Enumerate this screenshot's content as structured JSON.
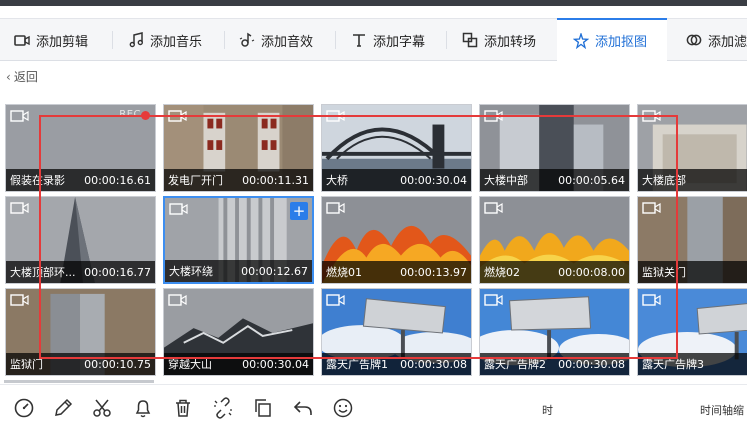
{
  "tabs": [
    {
      "label": "添加剪辑",
      "icon": "video-clip-icon"
    },
    {
      "label": "添加音乐",
      "icon": "music-note-icon"
    },
    {
      "label": "添加音效",
      "icon": "sound-effect-icon"
    },
    {
      "label": "添加字幕",
      "icon": "text-t-icon"
    },
    {
      "label": "添加转场",
      "icon": "transition-icon"
    },
    {
      "label": "添加抠图",
      "icon": "magic-star-icon",
      "active": true
    },
    {
      "label": "添加滤",
      "icon": "filter-icon"
    }
  ],
  "back": {
    "label": "返回"
  },
  "tiles": [
    {
      "name": "假装在录影",
      "duration": "00:00:16.61",
      "overlay": "REC"
    },
    {
      "name": "发电厂开门",
      "duration": "00:00:11.31"
    },
    {
      "name": "大桥",
      "duration": "00:00:30.04"
    },
    {
      "name": "大楼中部",
      "duration": "00:00:05.64"
    },
    {
      "name": "大楼底部",
      "duration": ""
    },
    {
      "name": "大楼顶部环...",
      "duration": "00:00:16.77"
    },
    {
      "name": "大楼环绕",
      "duration": "00:00:12.67",
      "selected": true,
      "add_label": "+"
    },
    {
      "name": "燃烧01",
      "duration": "00:00:13.97"
    },
    {
      "name": "燃烧02",
      "duration": "00:00:08.00"
    },
    {
      "name": "监狱关门",
      "duration": ""
    },
    {
      "name": "监狱门",
      "duration": "00:00:10.75"
    },
    {
      "name": "穿越大山",
      "duration": "00:00:30.04"
    },
    {
      "name": "露天广告牌1",
      "duration": "00:00:30.08"
    },
    {
      "name": "露天广告牌2",
      "duration": "00:00:30.08"
    },
    {
      "name": "露天广告牌3",
      "duration": ""
    }
  ],
  "toolbar": {
    "icons": [
      "speed-gauge-icon",
      "pencil-icon",
      "scissors-icon",
      "bell-icon",
      "trash-icon",
      "unlink-icon",
      "copy-icon",
      "undo-icon",
      "smiley-icon"
    ],
    "mid_text": "时",
    "right_text": "时间轴缩"
  },
  "colors": {
    "accent": "#2b7de9",
    "highlight_box": "#e53a3a"
  }
}
